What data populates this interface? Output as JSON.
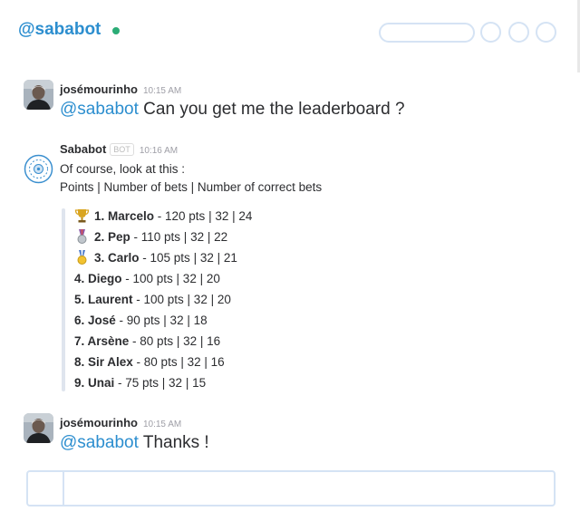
{
  "header": {
    "channel": "@sababot"
  },
  "messages": [
    {
      "author": "joséмourinho",
      "time": "10:15 AM",
      "mention": "@sababot",
      "text": " Can you get me the leaderboard ?"
    },
    {
      "author": "Sababot",
      "bot_tag": "BOT",
      "time": "10:16 AM",
      "line1": "Of course, look at this :",
      "line2": "Points | Number of bets | Number of correct bets"
    },
    {
      "author": "josémourinho",
      "time": "10:15 AM",
      "mention": "@sababot",
      "text": " Thanks !"
    }
  ],
  "leaderboard": [
    {
      "name": "1. Marcelo",
      "stats": " - 120 pts | 32 | 24",
      "icon": "trophy-icon"
    },
    {
      "name": "2. Pep",
      "stats": " - 110 pts | 32 | 22",
      "icon": "silver-medal-icon"
    },
    {
      "name": "3. Carlo",
      "stats": " - 105 pts | 32 | 21",
      "icon": "gold-medal-icon"
    },
    {
      "name": "4. Diego",
      "stats": " - 100 pts | 32 | 20"
    },
    {
      "name": "5. Laurent",
      "stats": " - 100 pts | 32 | 20"
    },
    {
      "name": "6. José",
      "stats": " - 90 pts | 32 | 18"
    },
    {
      "name": "7. Arsène",
      "stats": " - 80 pts | 32 | 16"
    },
    {
      "name": "8. Sir Alex",
      "stats": " - 80 pts | 32 | 16"
    },
    {
      "name": "9. Unai",
      "stats": " - 75 pts | 32 | 15"
    }
  ],
  "colors": {
    "accent": "#2c8ecf",
    "online": "#2bac76",
    "border": "#d5e3f4"
  }
}
